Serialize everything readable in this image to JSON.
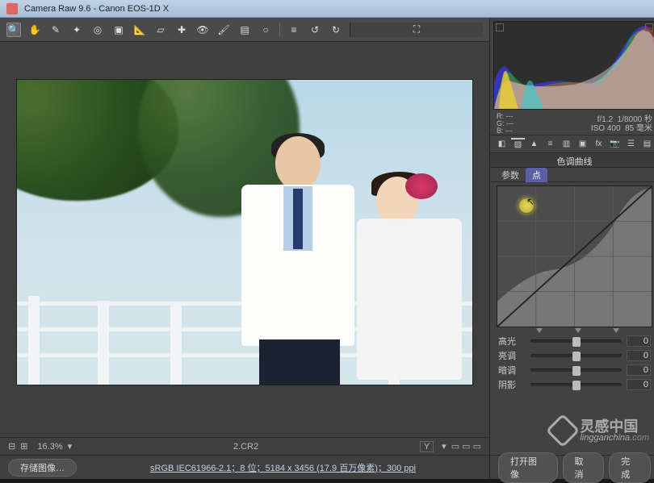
{
  "title": "Camera Raw 9.6  -  Canon EOS-1D X",
  "toolbar": {
    "icons": [
      "zoom",
      "hand",
      "eyedrop",
      "color-sampler",
      "target",
      "crop",
      "straighten",
      "transform",
      "spot",
      "redeye",
      "brush",
      "grad",
      "radial",
      "preferences",
      "rotate-left",
      "rotate-right"
    ],
    "right_icon": "fullscreen"
  },
  "status": {
    "zoom": "16.3%",
    "filename": "2.CR2",
    "preview_mode": "Y"
  },
  "bottom": {
    "save_label": "存储图像…",
    "profile": "sRGB IEC61966-2.1；8 位；5184 x 3456 (17.9 百万像素)；300 ppi",
    "open_label": "打开图像",
    "cancel_label": "取消",
    "done_label": "完成"
  },
  "readout": {
    "r_label": "R:",
    "r": "---",
    "g_label": "G:",
    "g": "---",
    "b_label": "B:",
    "b": "---",
    "aperture": "f/1.2",
    "shutter": "1/8000 秒",
    "iso": "ISO 400",
    "focal": "85 毫米"
  },
  "tabs": [
    "basic",
    "curve",
    "detail",
    "hsl",
    "split",
    "lens",
    "fx",
    "camera",
    "presets",
    "snapshots"
  ],
  "panel_title": "色调曲线",
  "subtabs": {
    "param": "参数",
    "point": "点"
  },
  "curve_markers": [
    0.25,
    0.5,
    0.75
  ],
  "sliders": [
    {
      "label": "高光",
      "value": 0
    },
    {
      "label": "亮调",
      "value": 0
    },
    {
      "label": "暗调",
      "value": 0
    },
    {
      "label": "阴影",
      "value": 0
    }
  ],
  "watermark": {
    "cn": "灵感中国",
    "en": "lingganchina",
    "tld": ".com"
  }
}
